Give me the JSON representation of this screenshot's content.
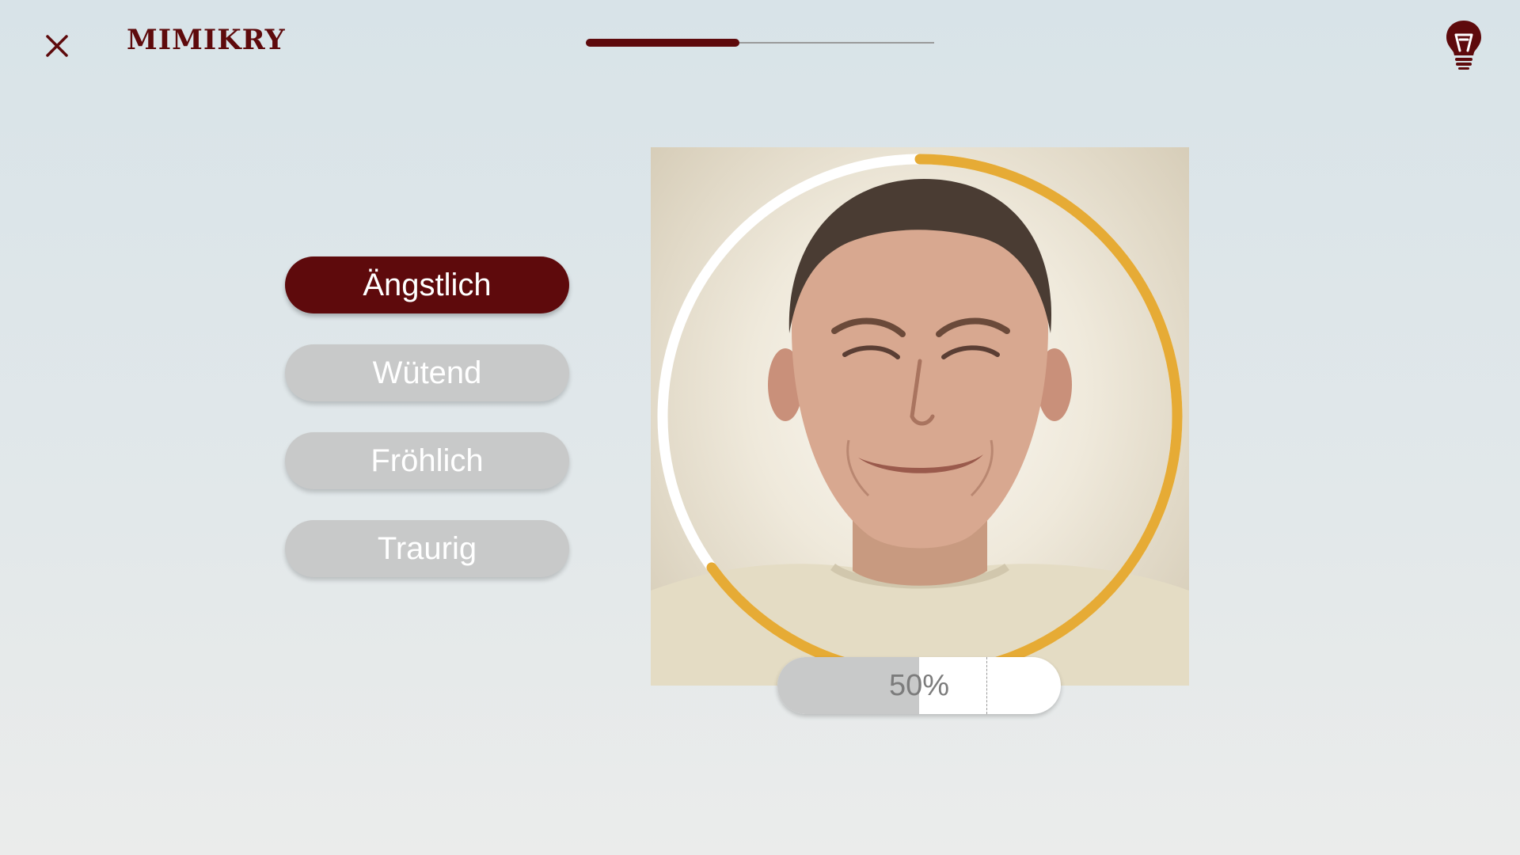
{
  "header": {
    "close_icon": "close-icon",
    "title": "MIMIKRY",
    "quiz_progress": 0.44,
    "hint_icon": "lightbulb-icon"
  },
  "answers": [
    {
      "label": "Ängstlich",
      "selected": true
    },
    {
      "label": "Wütend",
      "selected": false
    },
    {
      "label": "Fröhlich",
      "selected": false
    },
    {
      "label": "Traurig",
      "selected": false
    }
  ],
  "photo": {
    "subject": "man-grimacing-face-photo",
    "ring_progress": 0.65
  },
  "score": {
    "label": "50%",
    "value": 0.5,
    "target": 0.74
  },
  "colors": {
    "accent": "#5e0a0c",
    "inactive": "#c8c9c9",
    "ring": "#e6ab35",
    "ring_track": "#ffffff"
  }
}
